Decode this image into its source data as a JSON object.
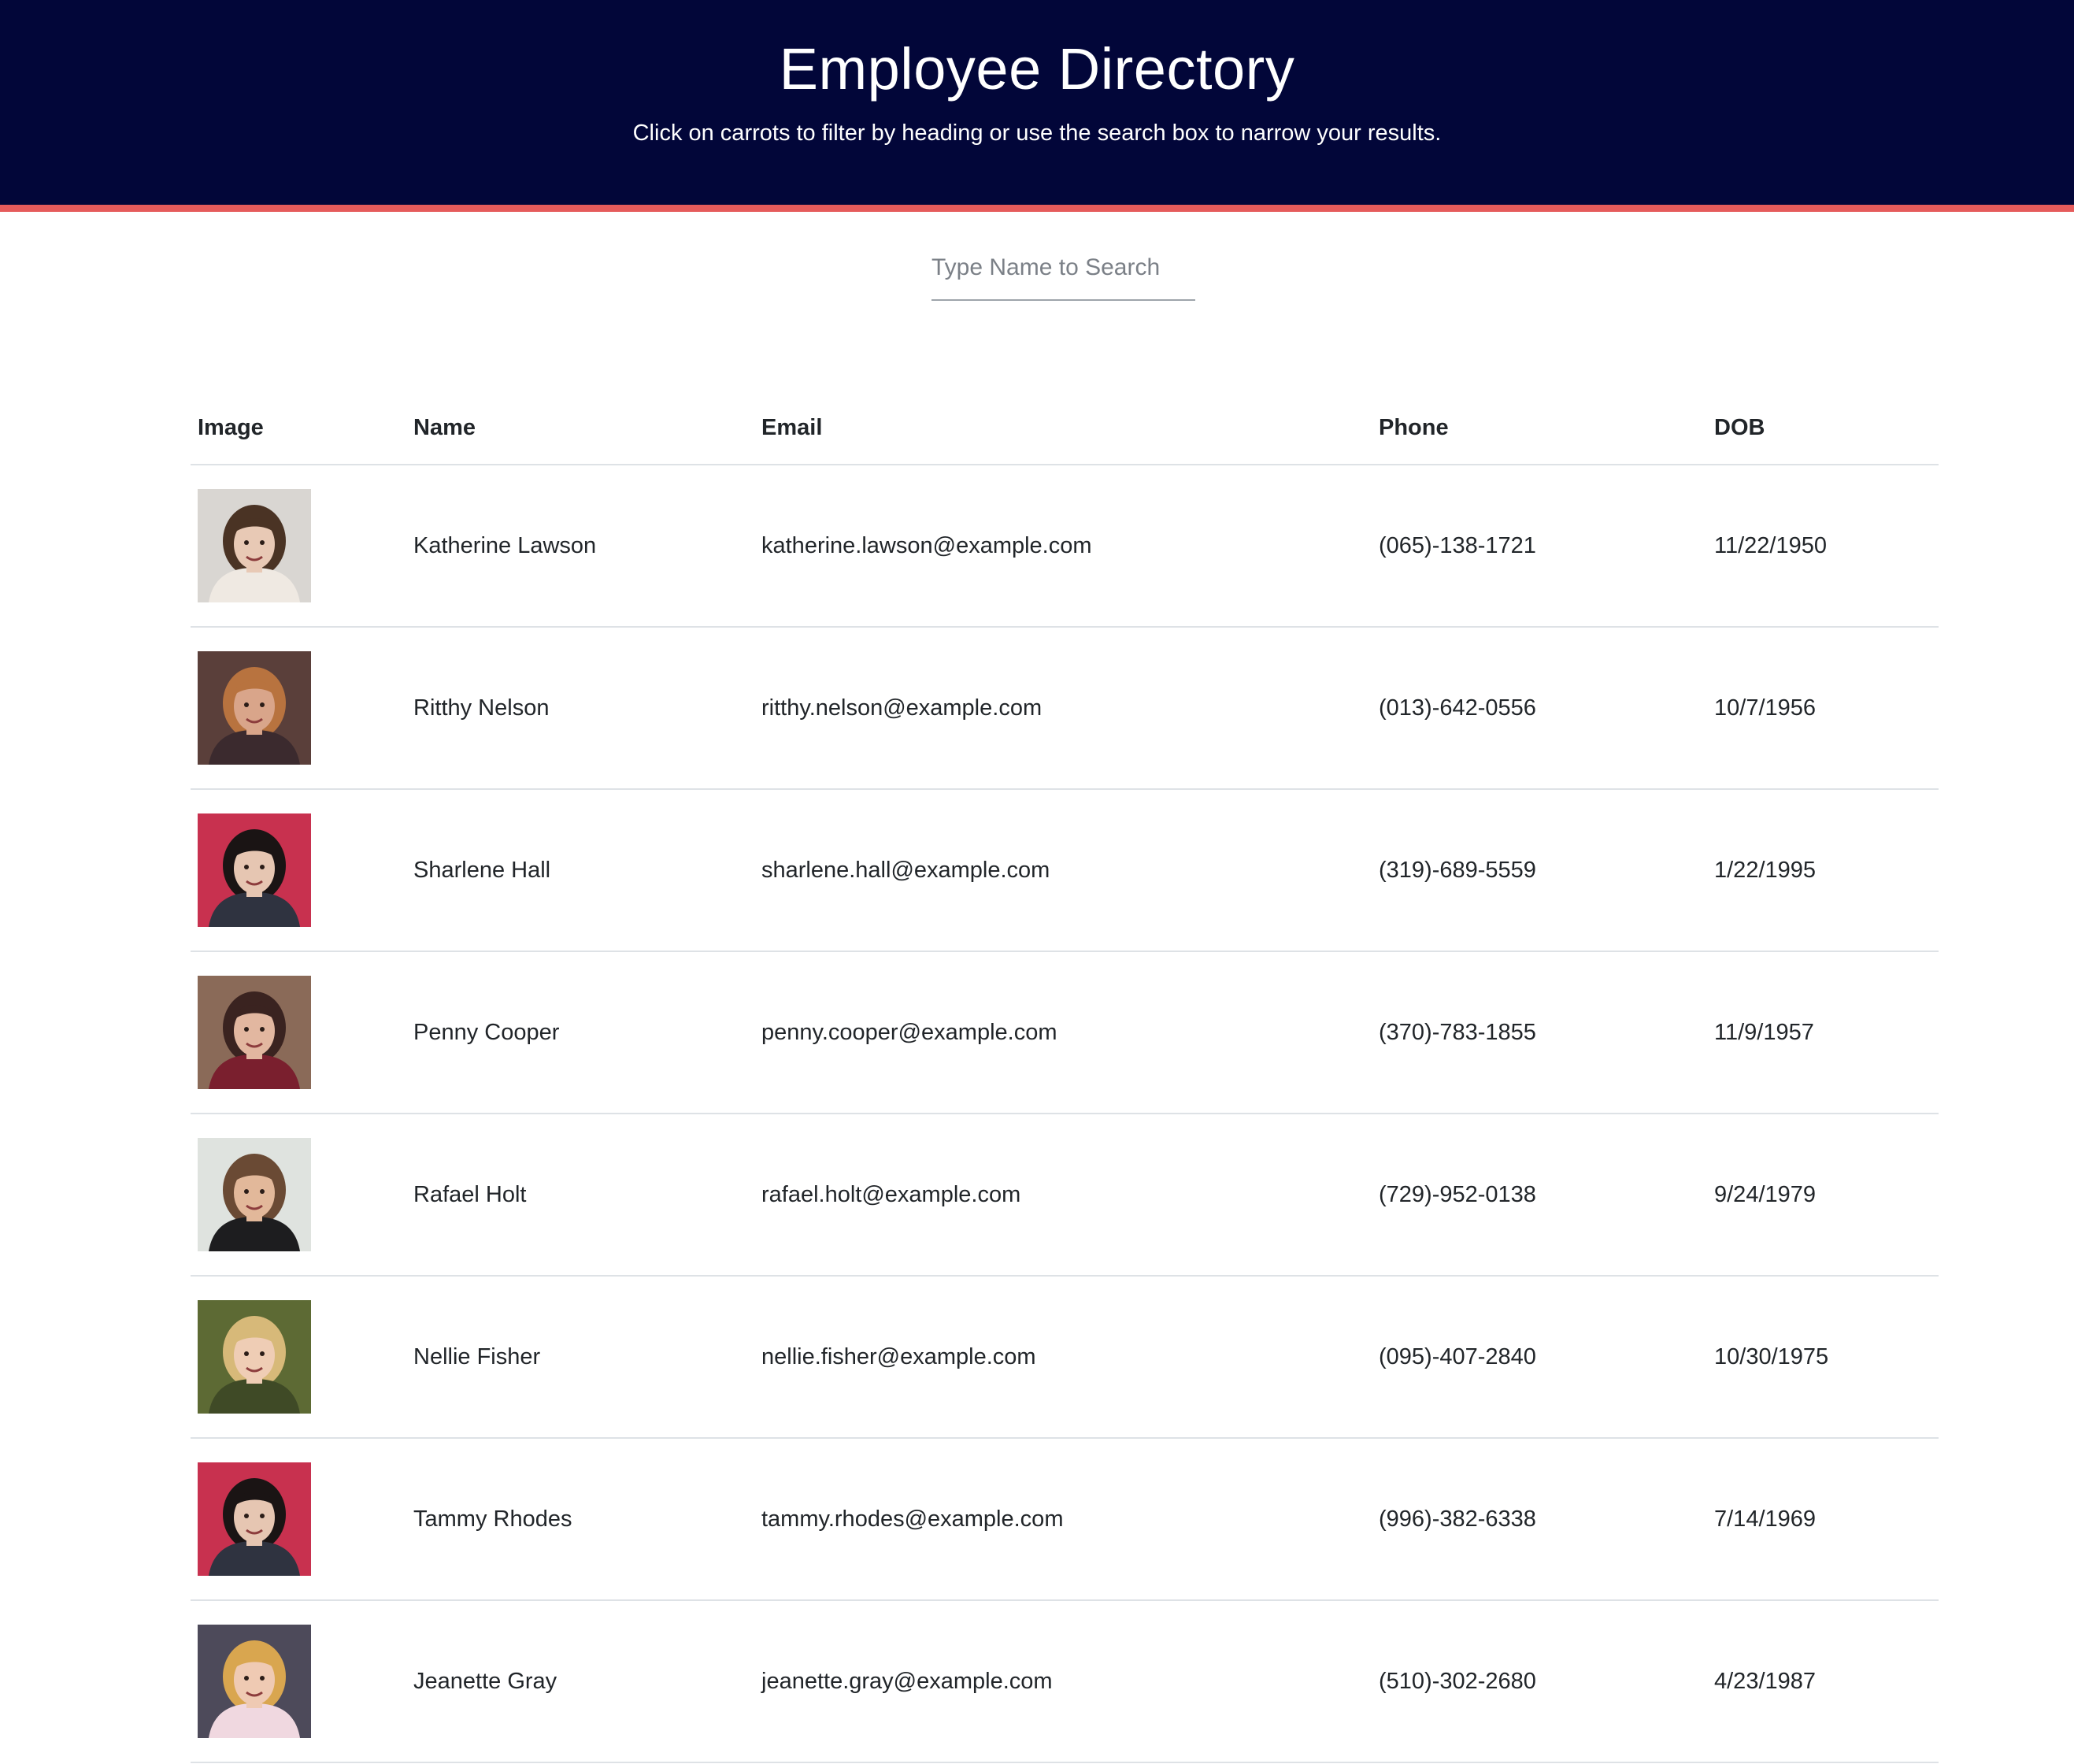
{
  "header": {
    "title": "Employee Directory",
    "subtitle": "Click on carrots to filter by heading or use the search box to narrow your results."
  },
  "search": {
    "placeholder": "Type Name to Search",
    "value": ""
  },
  "colors": {
    "header_bg": "#020639",
    "header_stripe": "#e55b5b",
    "text": "#212529",
    "row_border": "#dee2e6"
  },
  "table": {
    "columns": [
      "Image",
      "Name",
      "Email",
      "Phone",
      "DOB"
    ],
    "rows": [
      {
        "name": "Katherine Lawson",
        "email": "katherine.lawson@example.com",
        "phone": "(065)-138-1721",
        "dob": "11/22/1950",
        "photo": {
          "bg": "#d9d6d2",
          "hair": "#4a3324",
          "skin": "#e8c9b5",
          "shirt": "#efe9e2"
        }
      },
      {
        "name": "Ritthy Nelson",
        "email": "ritthy.nelson@example.com",
        "phone": "(013)-642-0556",
        "dob": "10/7/1956",
        "photo": {
          "bg": "#5a3f3a",
          "hair": "#b8733f",
          "skin": "#d9a58a",
          "shirt": "#3b2a2e"
        }
      },
      {
        "name": "Sharlene Hall",
        "email": "sharlene.hall@example.com",
        "phone": "(319)-689-5559",
        "dob": "1/22/1995",
        "photo": {
          "bg": "#c8314f",
          "hair": "#1a1414",
          "skin": "#e6c6b2",
          "shirt": "#2f3340"
        }
      },
      {
        "name": "Penny Cooper",
        "email": "penny.cooper@example.com",
        "phone": "(370)-783-1855",
        "dob": "11/9/1957",
        "photo": {
          "bg": "#8a6a58",
          "hair": "#3a2320",
          "skin": "#e2b7a0",
          "shirt": "#7a1f2e"
        }
      },
      {
        "name": "Rafael Holt",
        "email": "rafael.holt@example.com",
        "phone": "(729)-952-0138",
        "dob": "9/24/1979",
        "photo": {
          "bg": "#dfe3df",
          "hair": "#6a4a34",
          "skin": "#e2b89a",
          "shirt": "#1d1d1f"
        }
      },
      {
        "name": "Nellie Fisher",
        "email": "nellie.fisher@example.com",
        "phone": "(095)-407-2840",
        "dob": "10/30/1975",
        "photo": {
          "bg": "#5d6a34",
          "hair": "#d7b979",
          "skin": "#efcdb5",
          "shirt": "#3f4a26"
        }
      },
      {
        "name": "Tammy Rhodes",
        "email": "tammy.rhodes@example.com",
        "phone": "(996)-382-6338",
        "dob": "7/14/1969",
        "photo": {
          "bg": "#c8314f",
          "hair": "#1a1414",
          "skin": "#e6c6b2",
          "shirt": "#2f3340"
        }
      },
      {
        "name": "Jeanette Gray",
        "email": "jeanette.gray@example.com",
        "phone": "(510)-302-2680",
        "dob": "4/23/1987",
        "photo": {
          "bg": "#4d4a5a",
          "hair": "#d9a64f",
          "skin": "#efcab3",
          "shirt": "#f0d8e0"
        }
      }
    ]
  }
}
